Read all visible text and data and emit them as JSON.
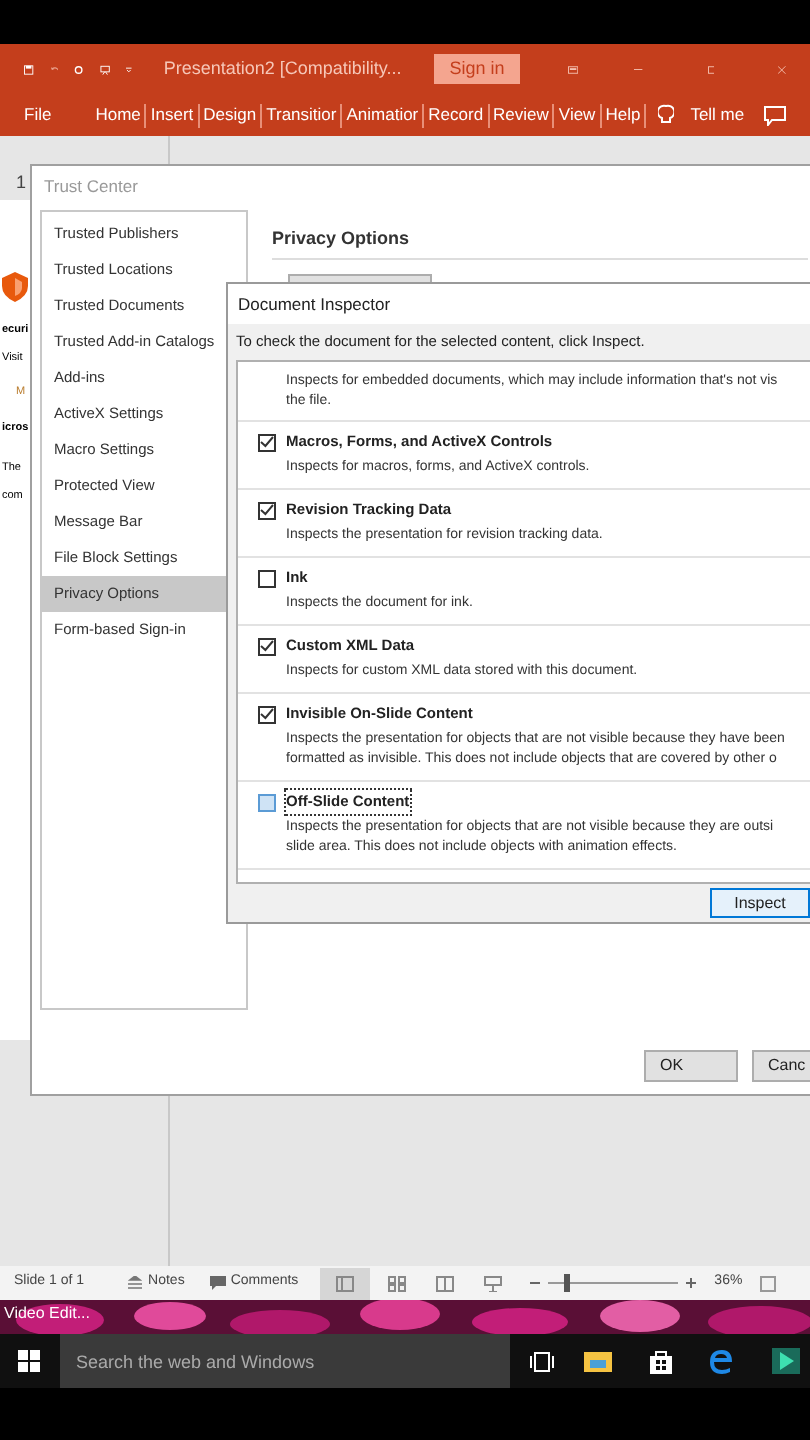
{
  "title_bar": {
    "title": "Presentation2 [Compatibility...",
    "sign_in": "Sign in"
  },
  "ribbon_tabs": [
    {
      "label": "File"
    },
    {
      "label": "Home"
    },
    {
      "label": "Insert"
    },
    {
      "label": "Design"
    },
    {
      "label": "Transitior"
    },
    {
      "label": "Animatior"
    },
    {
      "label": "Record"
    },
    {
      "label": "Review"
    },
    {
      "label": "View"
    },
    {
      "label": "Help"
    }
  ],
  "tell_me": "Tell me",
  "slide_number": "1",
  "background_dialog": {
    "fragments": [
      "ecuri",
      "Visit",
      "M",
      "icros",
      "The",
      "com"
    ]
  },
  "trust_center": {
    "title": "Trust Center",
    "heading": "Privacy Options",
    "nav": [
      {
        "label": "Trusted Publishers",
        "selected": false
      },
      {
        "label": "Trusted Locations",
        "selected": false
      },
      {
        "label": "Trusted Documents",
        "selected": false
      },
      {
        "label": "Trusted Add-in Catalogs",
        "selected": false
      },
      {
        "label": "Add-ins",
        "selected": false
      },
      {
        "label": "ActiveX Settings",
        "selected": false
      },
      {
        "label": "Macro Settings",
        "selected": false
      },
      {
        "label": "Protected View",
        "selected": false
      },
      {
        "label": "Message Bar",
        "selected": false
      },
      {
        "label": "File Block Settings",
        "selected": false
      },
      {
        "label": "Privacy Options",
        "selected": true
      },
      {
        "label": "Form-based Sign-in",
        "selected": false
      }
    ],
    "buttons": [
      "OK",
      "Canc"
    ]
  },
  "document_inspector": {
    "title": "Document Inspector",
    "instruction": "To check the document for the selected content, click Inspect.",
    "items": [
      {
        "kind": "partial",
        "lines": [
          "Inspects for embedded documents, which may include information that's not vis",
          "the file."
        ]
      },
      {
        "kind": "check",
        "title": "Macros, Forms, and ActiveX Controls",
        "checked": true,
        "focused": false,
        "lines": [
          "Inspects for macros, forms, and ActiveX controls."
        ]
      },
      {
        "kind": "check",
        "title": "Revision Tracking Data",
        "checked": true,
        "focused": false,
        "lines": [
          "Inspects the presentation for revision tracking data."
        ]
      },
      {
        "kind": "check",
        "title": "Ink",
        "checked": false,
        "focused": false,
        "lines": [
          "Inspects the document for ink."
        ]
      },
      {
        "kind": "check",
        "title": "Custom XML Data",
        "checked": true,
        "focused": false,
        "lines": [
          "Inspects for custom XML data stored with this document."
        ]
      },
      {
        "kind": "check",
        "title": "Invisible On-Slide Content",
        "checked": true,
        "focused": false,
        "lines": [
          "Inspects the presentation for objects that are not visible because they have been",
          "formatted as invisible. This does not include objects that are covered by other o"
        ]
      },
      {
        "kind": "check",
        "title": "Off-Slide Content",
        "checked": false,
        "focused": true,
        "lines": [
          "Inspects the presentation for objects that are not visible because they are outsi",
          "slide area.  This does not include objects with animation effects."
        ]
      }
    ],
    "button": "Inspect"
  },
  "status_bar": {
    "slide": "Slide 1 of 1",
    "notes": "Notes",
    "comments": "Comments",
    "zoom": "36%",
    "zoom_slider": {
      "level": 0.15
    }
  },
  "desktop_label": "Video Edit...",
  "taskbar": {
    "search_placeholder": "Search the web and Windows"
  }
}
